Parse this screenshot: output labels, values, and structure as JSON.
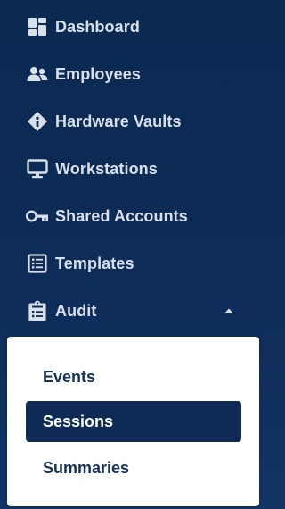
{
  "sidebar": {
    "items": [
      {
        "label": "Dashboard",
        "icon": "dashboard-icon"
      },
      {
        "label": "Employees",
        "icon": "employees-icon"
      },
      {
        "label": "Hardware Vaults",
        "icon": "hardware-vault-icon"
      },
      {
        "label": "Workstations",
        "icon": "monitor-icon"
      },
      {
        "label": "Shared Accounts",
        "icon": "key-icon"
      },
      {
        "label": "Templates",
        "icon": "template-icon"
      },
      {
        "label": "Audit",
        "icon": "clipboard-icon",
        "expanded": true
      }
    ],
    "audit_submenu": {
      "items": [
        {
          "label": "Events",
          "active": false
        },
        {
          "label": "Sessions",
          "active": true
        },
        {
          "label": "Summaries",
          "active": false
        }
      ]
    }
  },
  "colors": {
    "sidebar_bg": "#0c2b55",
    "nav_text": "#d9e0ea",
    "submenu_bg": "#ffffff",
    "submenu_text": "#16305a",
    "active_bg": "#0f2b55",
    "active_text": "#ffffff"
  }
}
